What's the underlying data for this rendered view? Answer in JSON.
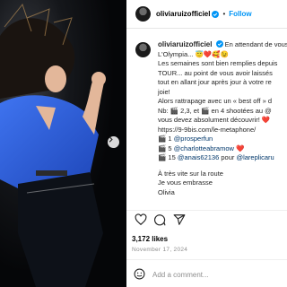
{
  "post": {
    "username": "oliviaruizofficiel",
    "follow_label": "Follow",
    "separator": "•"
  },
  "caption": {
    "username": "oliviaruizofficiel",
    "lines": [
      "En attendant de vous",
      "L'Olympia... 😇❤️🥰😉",
      "Les semaines sont bien remplies depuis",
      "TOUR... au point de vous avoir laissés",
      "tout en allant jour après jour à votre re",
      "joie!",
      "Alors rattrapage avec un « best off » d",
      "Nb: 🎬 2,3, et 🎬 en 4 shootées au @",
      "vous devez absolument découvrir! ❤️",
      "https://9-9bis.com/le-metaphone/",
      "🎬 1 @prosperfun",
      "🎬 5 @charlotteabramow ❤️",
      "🎬 15 @anais62136 pour @lareplicaru",
      "",
      "À très vite sur la route",
      "Je vous embrasse",
      "Olivia"
    ],
    "mentions": {
      "m1": "@prosperfun",
      "m2": "@charlotteabramow",
      "m3": "@anais62136",
      "m4": "@lareplicaru"
    }
  },
  "stats": {
    "likes": "3,172 likes",
    "date": "November 17, 2024"
  },
  "comment": {
    "placeholder": "Add a comment..."
  },
  "icons": {
    "verified": "verified-badge-icon",
    "like": "heart-icon",
    "comment": "comment-icon",
    "share": "share-icon",
    "emoji": "emoji-icon",
    "next": "chevron-right-icon"
  },
  "colors": {
    "follow": "#0095f6",
    "mention": "#00376b",
    "photo_shirt": "#2d5bd6"
  }
}
